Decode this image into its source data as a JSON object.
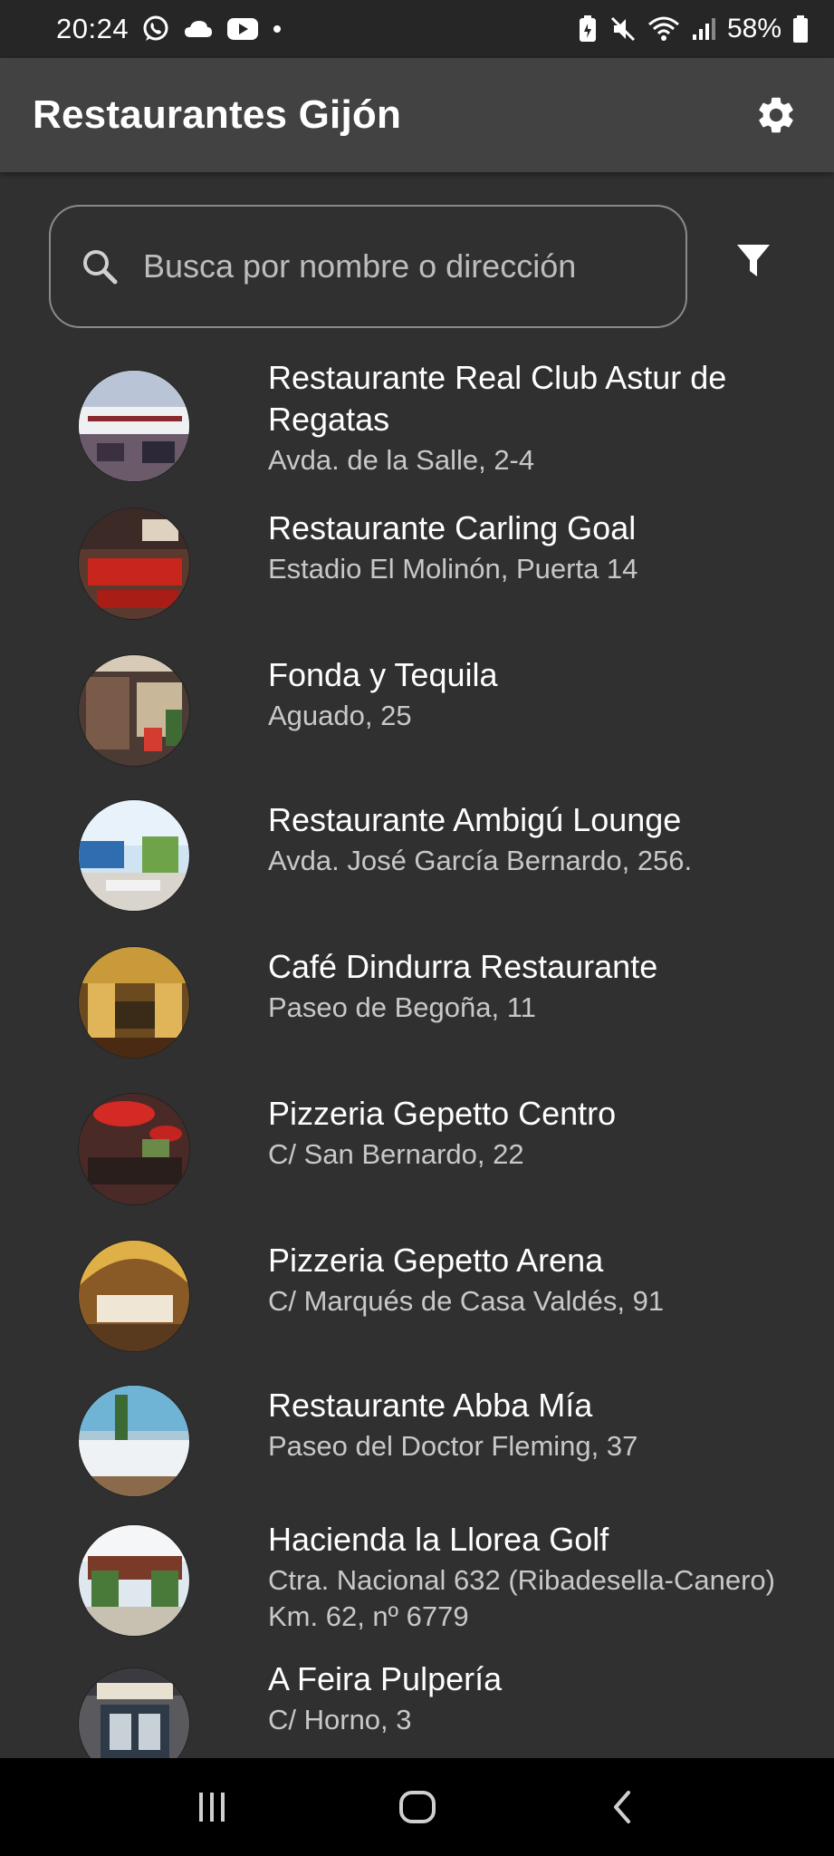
{
  "status_bar": {
    "time": "20:24",
    "battery": "58%",
    "left_icons": [
      "whatsapp-icon",
      "cloud-icon",
      "youtube-icon",
      "dot-icon"
    ],
    "right_icons": [
      "battery-saver-icon",
      "mute-icon",
      "wifi-icon",
      "signal-icon",
      "battery-icon"
    ]
  },
  "app_bar": {
    "title": "Restaurantes Gijón",
    "settings_icon": "gear-icon"
  },
  "search": {
    "placeholder": "Busca por nombre o dirección",
    "value": "",
    "icon": "search-icon",
    "filter_icon": "filter-icon"
  },
  "restaurants": [
    {
      "name": "Restaurante Real Club Astur de Regatas",
      "address": "Avda. de la Salle, 2-4"
    },
    {
      "name": "Restaurante Carling Goal",
      "address": "Estadio El Molinón, Puerta 14"
    },
    {
      "name": "Fonda y Tequila",
      "address": "Aguado, 25"
    },
    {
      "name": "Restaurante Ambigú Lounge",
      "address": "Avda. José García Bernardo, 256."
    },
    {
      "name": "Café Dindurra Restaurante",
      "address": "Paseo de Begoña, 11"
    },
    {
      "name": "Pizzeria Gepetto Centro",
      "address": "C/ San Bernardo, 22"
    },
    {
      "name": "Pizzeria Gepetto Arena",
      "address": "C/ Marqués de Casa Valdés, 91"
    },
    {
      "name": "Restaurante Abba Mía",
      "address": "Paseo del Doctor Fleming, 37"
    },
    {
      "name": "Hacienda la Llorea Golf",
      "address": "Ctra. Nacional 632 (Ribadesella-Canero) Km. 62, nº 6779"
    },
    {
      "name": "A Feira Pulpería",
      "address": "C/ Horno, 3"
    }
  ],
  "nav_bar": {
    "icons": [
      "recent-apps-icon",
      "home-icon",
      "back-icon"
    ]
  },
  "colors": {
    "background": "#303030",
    "app_bar": "#424242",
    "status_bar": "#262626",
    "nav_bar": "#000000",
    "text_primary": "#ffffff",
    "text_secondary": "#c8c8c8",
    "search_border": "#8a8a8a"
  }
}
